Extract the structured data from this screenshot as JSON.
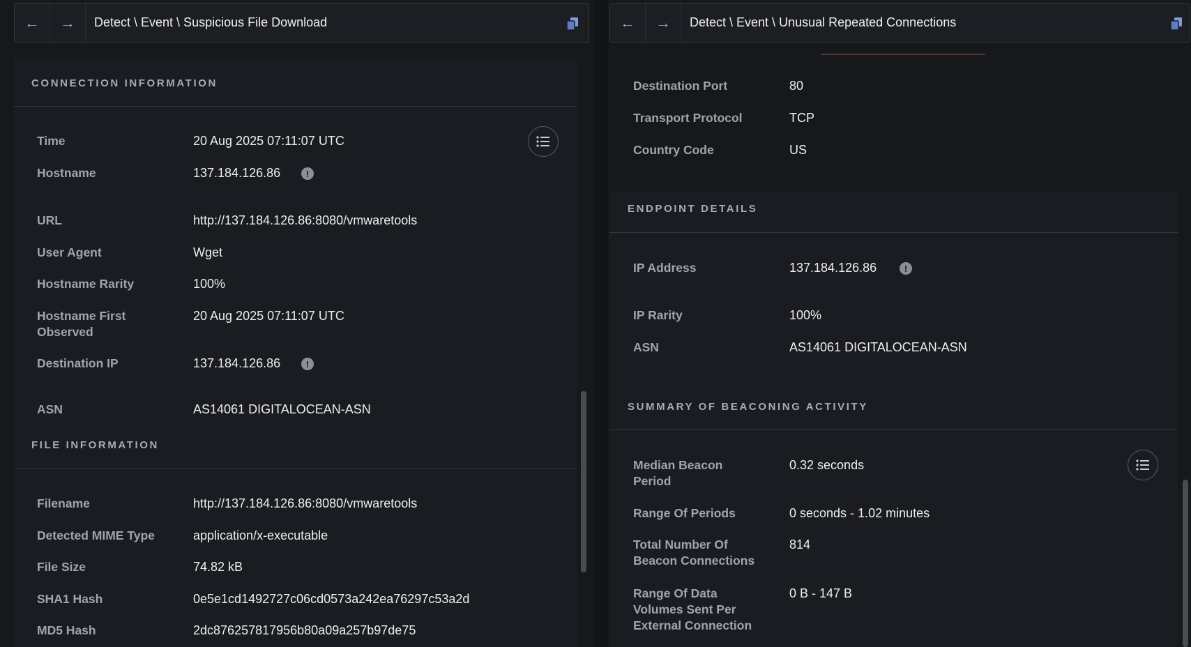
{
  "left": {
    "breadcrumb": "Detect \\ Event \\ Suspicious File Download",
    "connection": {
      "title": "CONNECTION INFORMATION",
      "rows": [
        {
          "label": "Time",
          "value": "20 Aug 2025 07:11:07 UTC"
        },
        {
          "label": "Hostname",
          "value": "137.184.126.86"
        },
        {
          "label": "URL",
          "value": "http://137.184.126.86:8080/vmwaretools"
        },
        {
          "label": "User Agent",
          "value": "Wget"
        },
        {
          "label": "Hostname Rarity",
          "value": "100%"
        },
        {
          "label": "Hostname First",
          "label2": "Observed",
          "value": "20 Aug 2025 07:11:07 UTC"
        },
        {
          "label": "Destination IP",
          "value": "137.184.126.86"
        },
        {
          "label": "ASN",
          "value": "AS14061 DIGITALOCEAN-ASN"
        }
      ]
    },
    "file": {
      "title": "FILE INFORMATION",
      "rows": [
        {
          "label": "Filename",
          "value": "http://137.184.126.86:8080/vmwaretools"
        },
        {
          "label": "Detected MIME Type",
          "value": "application/x-executable"
        },
        {
          "label": "File Size",
          "value": "74.82 kB"
        },
        {
          "label": "SHA1 Hash",
          "value": "0e5e1cd1492727c06cd0573a242ea76297c53a2d"
        },
        {
          "label": "MD5 Hash",
          "value": "2dc876257817956b80a09a257b97de75"
        }
      ]
    }
  },
  "right": {
    "breadcrumb": "Detect \\ Event \\ Unusual Repeated Connections",
    "top_rows": [
      {
        "label": "Destination Port",
        "value": "80"
      },
      {
        "label": "Transport Protocol",
        "value": "TCP"
      },
      {
        "label": "Country Code",
        "value": "US"
      }
    ],
    "endpoint": {
      "title": "ENDPOINT DETAILS",
      "rows": [
        {
          "label": "IP Address",
          "value": "137.184.126.86"
        },
        {
          "label": "IP Rarity",
          "value": "100%"
        },
        {
          "label": "ASN",
          "value": "AS14061 DIGITALOCEAN-ASN"
        }
      ]
    },
    "beacon": {
      "title": "SUMMARY OF BEACONING ACTIVITY",
      "rows": [
        {
          "label": "Median Beacon",
          "label2": "Period",
          "value": "0.32 seconds"
        },
        {
          "label": "Range Of Periods",
          "value": "0 seconds - 1.02 minutes"
        },
        {
          "label": "Total Number Of",
          "label2": "Beacon Connections",
          "value": "814"
        },
        {
          "label": "Range Of Data",
          "label2": "Volumes Sent Per",
          "label3": "External Connection",
          "value": "0 B - 147 B"
        }
      ]
    }
  },
  "icons": {
    "back": "arrow-left-icon",
    "forward": "arrow-right-icon",
    "copy": "copy-icon",
    "info": "info-icon",
    "list": "list-icon"
  },
  "colors": {
    "background": "#17181c",
    "panel": "#1b1c21",
    "label": "#a2a4ab",
    "value": "#eceef1",
    "section_title": "#a9abb2"
  }
}
